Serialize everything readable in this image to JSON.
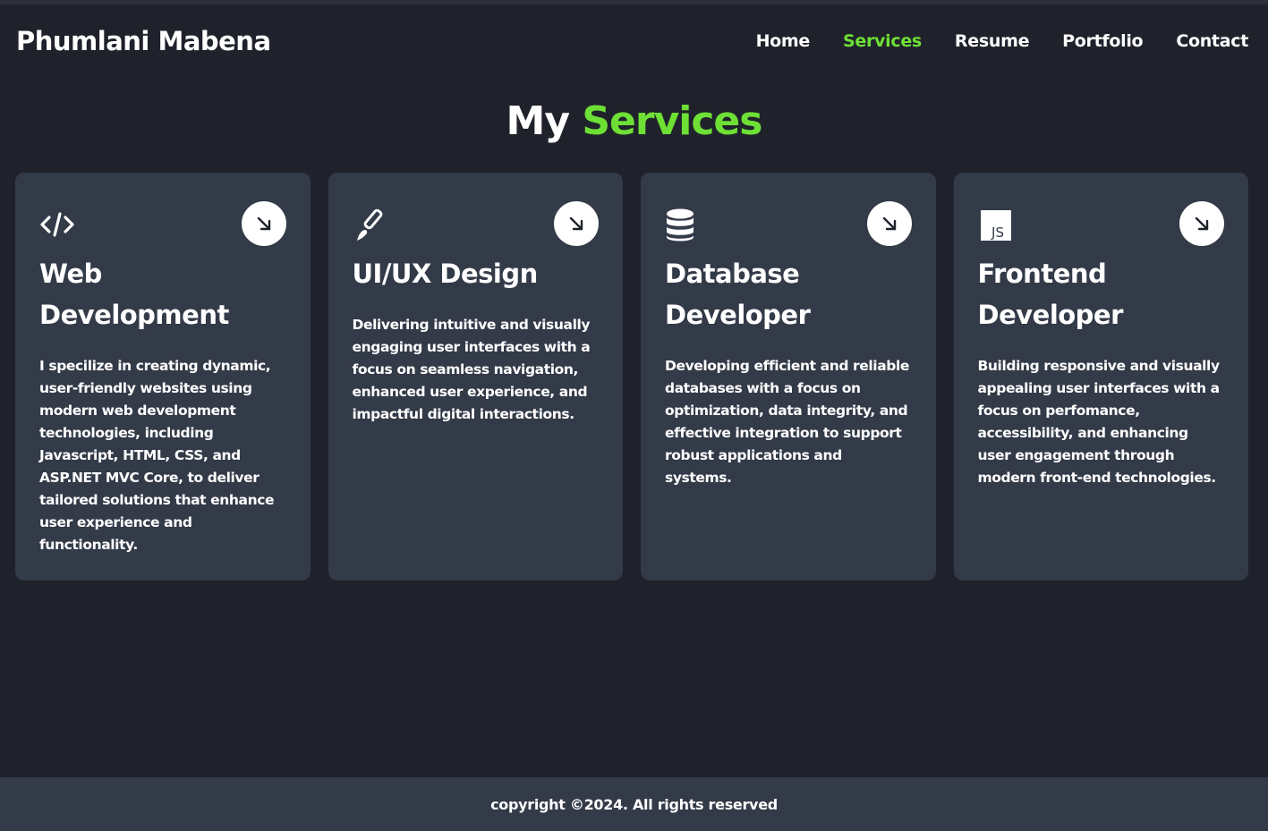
{
  "header": {
    "brand": "Phumlani Mabena",
    "nav": [
      {
        "label": "Home",
        "active": false
      },
      {
        "label": "Services",
        "active": true
      },
      {
        "label": "Resume",
        "active": false
      },
      {
        "label": "Portfolio",
        "active": false
      },
      {
        "label": "Contact",
        "active": false
      }
    ]
  },
  "section": {
    "title_prefix": "My",
    "title_accent": "Services"
  },
  "services": [
    {
      "icon": "code-icon",
      "title": "Web Development",
      "description": "I specilize in creating dynamic, user-friendly websites using modern web development technologies, including Javascript, HTML, CSS, and ASP.NET MVC Core, to deliver tailored solutions that enhance user experience and functionality."
    },
    {
      "icon": "paintbrush-icon",
      "title": "UI/UX Design",
      "description": "Delivering intuitive and visually engaging user interfaces with a focus on seamless navigation, enhanced user experience, and impactful digital interactions."
    },
    {
      "icon": "database-icon",
      "title": "Database Developer",
      "description": "Developing efficient and reliable databases with a focus on optimization, data integrity, and effective integration to support robust applications and systems."
    },
    {
      "icon": "javascript-icon",
      "title": "Frontend Developer",
      "description": "Building responsive and visually appealing user interfaces with a focus on perfomance, accessibility, and enhancing user engagement through modern front-end technologies."
    }
  ],
  "footer": {
    "copyright": "copyright ©2024. All rights reserved"
  },
  "colors": {
    "background": "#1f222b",
    "card": "#333a48",
    "accent": "#6ee035",
    "text": "#ffffff"
  }
}
